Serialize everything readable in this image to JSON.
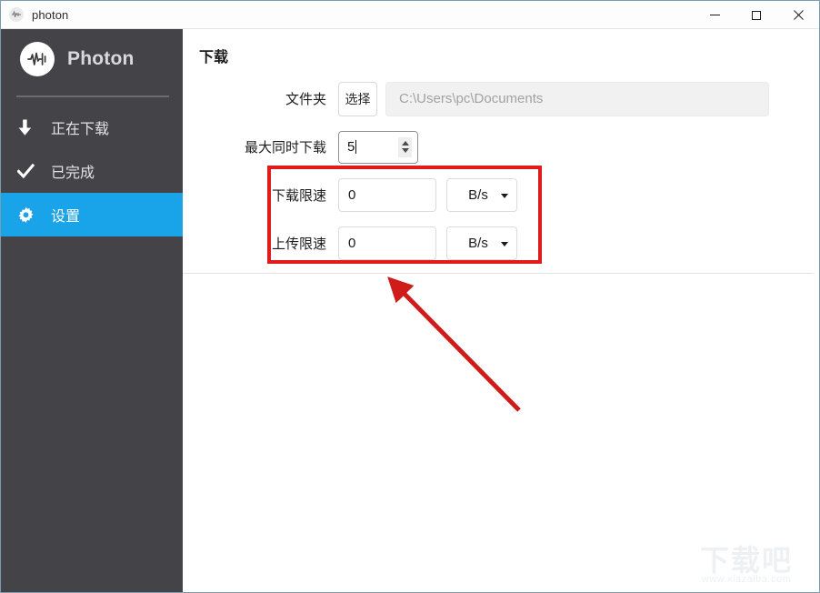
{
  "window": {
    "title": "photon",
    "icon": "waveform-icon",
    "minimize_label": "—",
    "maximize_label": "□",
    "close_label": "✕"
  },
  "sidebar": {
    "brand": "Photon",
    "brand_icon": "waveform-icon",
    "items": [
      {
        "label": "正在下载",
        "icon": "download-arrow-icon",
        "active": false
      },
      {
        "label": "已完成",
        "icon": "check-icon",
        "active": false
      },
      {
        "label": "设置",
        "icon": "gear-icon",
        "active": true
      }
    ],
    "active_color": "#19a3e8",
    "background_color": "#444448"
  },
  "content": {
    "page_title": "下载",
    "folder": {
      "label": "文件夹",
      "button_label": "选择",
      "path_value": "C:\\Users\\pc\\Documents"
    },
    "max_concurrent": {
      "label": "最大同时下载",
      "value": "5"
    },
    "download_limit": {
      "label": "下载限速",
      "value": "0",
      "unit": "B/s"
    },
    "upload_limit": {
      "label": "上传限速",
      "value": "0",
      "unit": "B/s"
    }
  },
  "annotations": {
    "highlight_color": "#e01b1b",
    "arrow_color": "#d01b1b"
  },
  "watermark": {
    "text_cn": "下载吧",
    "url": "www.xiazaiba.com"
  }
}
